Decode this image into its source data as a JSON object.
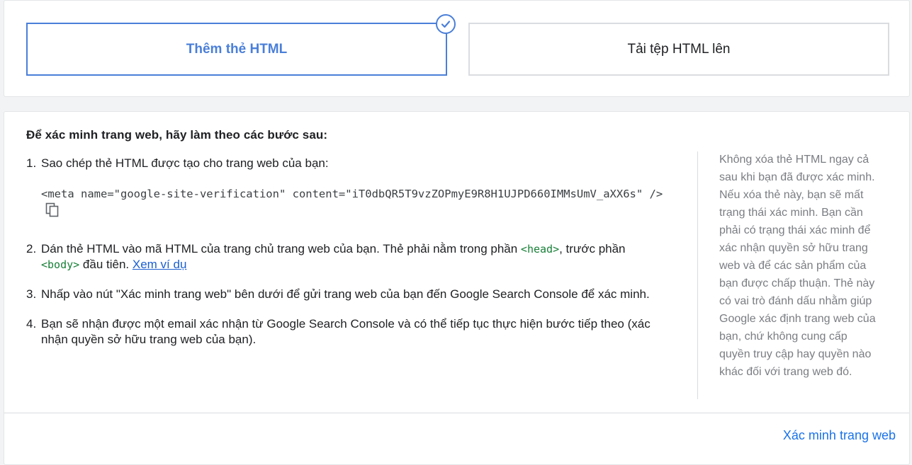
{
  "options": {
    "html_tag_label": "Thêm thẻ HTML",
    "upload_label": "Tải tệp HTML lên"
  },
  "instructions": {
    "title": "Để xác minh trang web, hãy làm theo các bước sau:",
    "step1": "Sao chép thẻ HTML được tạo cho trang web của bạn:",
    "meta_tag": "<meta name=\"google-site-verification\" content=\"iT0dbQR5T9vzZOPmyE9R8H1UJPD660IMMsUmV_aXX6s\" />",
    "step2_part1": "Dán thẻ HTML vào mã HTML của trang chủ trang web của bạn. Thẻ phải nằm trong phần ",
    "step2_head": "<head>",
    "step2_part2": ", trước phần ",
    "step2_body": "<body>",
    "step2_part3": " đầu tiên. ",
    "step2_link": "Xem ví dụ",
    "step3": "Nhấp vào nút \"Xác minh trang web\" bên dưới để gửi trang web của bạn đến Google Search Console để xác minh.",
    "step4": "Bạn sẽ nhận được một email xác nhận từ Google Search Console và có thể tiếp tục thực hiện bước tiếp theo (xác nhận quyền sở hữu trang web của bạn)."
  },
  "side_note": "Không xóa thẻ HTML ngay cả sau khi bạn đã được xác minh. Nếu xóa thẻ này, bạn sẽ mất trạng thái xác minh. Bạn cần phải có trạng thái xác minh để xác nhận quyền sở hữu trang web và để các sản phẩm của bạn được chấp thuận. Thẻ này có vai trò đánh dấu nhằm giúp Google xác định trang web của bạn, chứ không cung cấp quyền truy cập hay quyền nào khác đối với trang web đó.",
  "verify_button": "Xác minh trang web",
  "colors": {
    "accent": "#4a7fd9",
    "link": "#1a73e8",
    "code_tag": "#188038"
  },
  "icons": [
    "check-circle-icon",
    "copy-icon"
  ]
}
